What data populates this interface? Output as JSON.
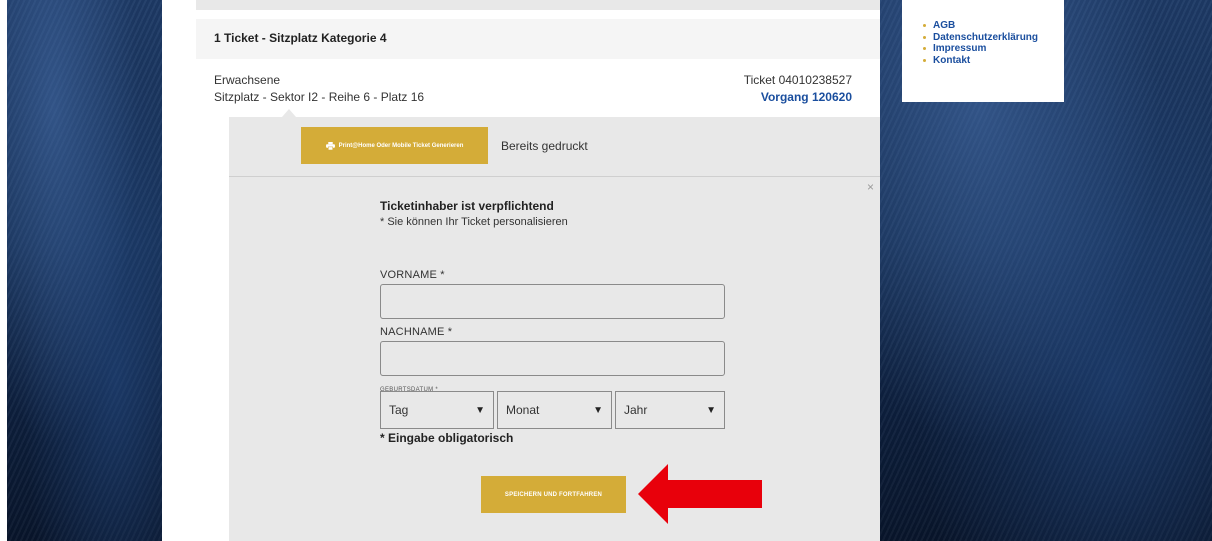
{
  "ticket": {
    "header_title": "1 Ticket - Sitzplatz Kategorie 4",
    "type": "Erwachsene",
    "seat": "Sitzplatz - Sektor I2 - Reihe 6 - Platz 16",
    "number": "Ticket 04010238527",
    "vorgang": "Vorgang 120620"
  },
  "tabs": {
    "print_button": "Print@Home Oder Mobile Ticket Generieren",
    "printed": "Bereits gedruckt"
  },
  "form": {
    "close": "×",
    "title": "Ticketinhaber ist verpflichtend",
    "subtitle": "* Sie können Ihr Ticket personalisieren",
    "vorname_label": "VORNAME *",
    "vorname_value": "",
    "nachname_label": "NACHNAME  *",
    "nachname_value": "",
    "geburtsdatum_label": "GEBURTSDATUM  *",
    "day": "Tag",
    "month": "Monat",
    "year": "Jahr",
    "required_note": "* Eingabe obligatorisch",
    "save_button": "SPEICHERN UND FORTFAHREN"
  },
  "menu": {
    "items": [
      "AGB",
      "Datenschutzerklärung",
      "Impressum",
      "Kontakt"
    ]
  },
  "colors": {
    "accent": "#d4ac38",
    "link": "#1a4e9e",
    "arrow": "#e8000b"
  },
  "icons": {
    "print": "printer-icon",
    "caret": "caret-down-icon",
    "arrow": "arrow-left-icon"
  }
}
